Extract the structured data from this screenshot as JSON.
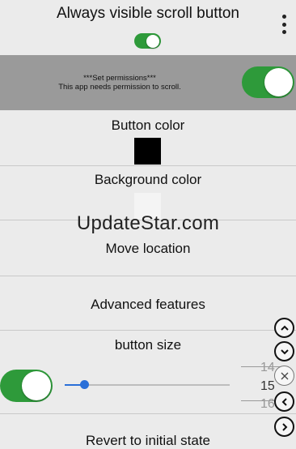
{
  "header": {
    "title": "Always visible scroll button",
    "menu_icon": "more-vert-icon",
    "enabled": true
  },
  "permissions": {
    "line1": "***Set permissions***",
    "line2": "This app needs permission to scroll.",
    "enabled": true
  },
  "button_color": {
    "label": "Button color",
    "color": "#000000"
  },
  "background_color": {
    "label": "Background color",
    "color": "#f4f4f4"
  },
  "watermark": "UpdateStar.com",
  "move_location": {
    "label": "Move location"
  },
  "advanced": {
    "label": "Advanced features"
  },
  "button_size": {
    "label": "button size",
    "enabled": true,
    "slider_fraction": 0.12,
    "picker": {
      "prev": "14",
      "current": "15",
      "next": "16"
    }
  },
  "revert": {
    "label": "Revert to initial state"
  },
  "floating_buttons": [
    {
      "name": "scroll-top-button",
      "icon": "chevron-up-icon"
    },
    {
      "name": "scroll-bottom-button",
      "icon": "chevron-down-icon"
    },
    {
      "name": "close-button",
      "icon": "close-icon"
    },
    {
      "name": "scroll-left-button",
      "icon": "chevron-left-icon"
    },
    {
      "name": "scroll-right-button",
      "icon": "chevron-right-icon"
    }
  ],
  "colors": {
    "accent": "#2e9a3a",
    "slider": "#2a6fd8"
  }
}
